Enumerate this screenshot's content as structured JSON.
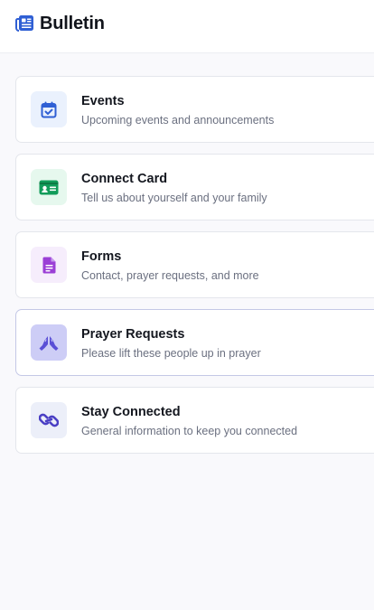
{
  "header": {
    "title": "Bulletin",
    "icon": "newspaper-icon",
    "icon_color": "#2f5fd4"
  },
  "cards": [
    {
      "title": "Events",
      "subtitle": "Upcoming events and announcements",
      "icon": "calendar-check-icon",
      "icon_color": "#2f5fd4",
      "icon_bg": "#eaf1fd"
    },
    {
      "title": "Connect Card",
      "subtitle": "Tell us about yourself and your family",
      "icon": "id-card-icon",
      "icon_color": "#129c5a",
      "icon_bg": "#e6f8ee"
    },
    {
      "title": "Forms",
      "subtitle": "Contact, prayer requests, and more",
      "icon": "document-icon",
      "icon_color": "#9b3fd6",
      "icon_bg": "#f6edfc"
    },
    {
      "title": "Prayer Requests",
      "subtitle": "Please lift these people up in prayer",
      "icon": "praying-hands-icon",
      "icon_color": "#5a4fd6",
      "icon_bg": "#cdcdf6"
    },
    {
      "title": "Stay Connected",
      "subtitle": "General information to keep you connected",
      "icon": "link-icon",
      "icon_color": "#4a3fc4",
      "icon_bg": "#eceff9"
    }
  ]
}
